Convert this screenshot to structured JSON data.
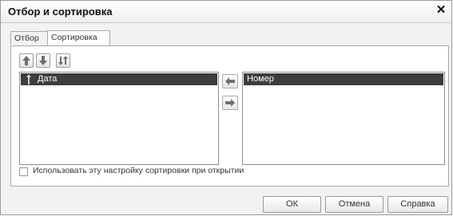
{
  "window": {
    "title": "Отбор и сортировка",
    "close_glyph": "✕"
  },
  "tabs": [
    {
      "label": "Отбор"
    },
    {
      "label": "Сортировка",
      "active": true
    }
  ],
  "toolbar": {
    "move_up_icon": "arrow-up-icon",
    "move_down_icon": "arrow-down-icon",
    "sort_direction_icon": "sort-toggle-icon"
  },
  "selected_fields": {
    "items": [
      {
        "label": "Дата",
        "direction_icon": "sort-ascending-icon"
      }
    ]
  },
  "available_fields": {
    "items": [
      {
        "label": "Номер"
      }
    ]
  },
  "transfer": {
    "add_icon": "arrow-left-icon",
    "remove_icon": "arrow-right-icon"
  },
  "options": {
    "use_on_open_label": "Использовать эту настройку сортировки при открытии",
    "use_on_open_checked": false
  },
  "buttons": {
    "ok": "ОК",
    "cancel": "Отмена",
    "help": "Справка"
  },
  "colors": {
    "selection": "#3d3d3d",
    "icon": "#6f6f6f"
  }
}
